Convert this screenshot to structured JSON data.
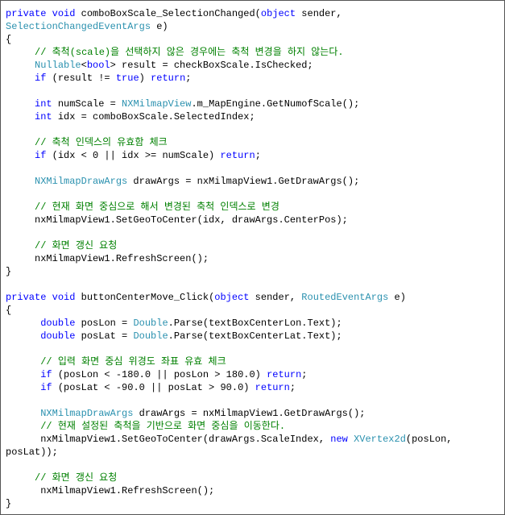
{
  "code": {
    "t1": "private",
    "t2": "void",
    "t3": " comboBoxScale_SelectionChanged(",
    "t4": "object",
    "t5": " sender,",
    "t6": "SelectionChangedEventArgs",
    "t7": " e)",
    "t8": "{",
    "t9": "     ",
    "t10": "// 축척(scale)을 선택하지 않은 경우에는 축척 변경을 하지 않는다.",
    "t11": "     ",
    "t12": "Nullable",
    "t13": "<",
    "t14": "bool",
    "t15": "> result = checkBoxScale.IsChecked;",
    "t16": "     ",
    "t17": "if",
    "t18": " (result != ",
    "t19": "true",
    "t20": ") ",
    "t21": "return",
    "t22": ";",
    "t24": "     ",
    "t25": "int",
    "t26": " numScale = ",
    "t27": "NXMilmapView",
    "t28": ".m_MapEngine.GetNumofScale();",
    "t29": "     ",
    "t30": "int",
    "t31": " idx = comboBoxScale.SelectedIndex;",
    "t33": "     ",
    "t34": "// 축척 인덱스의 유효함 체크",
    "t35": "     ",
    "t36": "if",
    "t37": " (idx < 0 || idx >= numScale) ",
    "t38": "return",
    "t39": ";",
    "t41": "     ",
    "t42": "NXMilmapDrawArgs",
    "t43": " drawArgs = nxMilmapView1.GetDrawArgs();",
    "t45": "     ",
    "t46": "// 현재 화면 중심으로 해서 변경된 축척 인덱스로 변경",
    "t47": "     nxMilmapView1.SetGeoToCenter(idx, drawArgs.CenterPos);",
    "t49": "     ",
    "t50": "// 화면 갱신 요청",
    "t51": "     nxMilmapView1.RefreshScreen();",
    "t52": "}",
    "s1": "private",
    "s2": "void",
    "s3": " buttonCenterMove_Click(",
    "s4": "object",
    "s5": " sender, ",
    "s6": "RoutedEventArgs",
    "s7": " e)",
    "s8": "{",
    "s9": "      ",
    "s10": "double",
    "s11": " posLon = ",
    "s12": "Double",
    "s13": ".Parse(textBoxCenterLon.Text);",
    "s14": "      ",
    "s15": "double",
    "s16": " posLat = ",
    "s17": "Double",
    "s18": ".Parse(textBoxCenterLat.Text);",
    "s20": "      ",
    "s21": "// 입력 화면 중심 위경도 좌표 유효 체크",
    "s22": "      ",
    "s23": "if",
    "s24": " (posLon < -180.0 || posLon > 180.0) ",
    "s25": "return",
    "s26": ";",
    "s27": "      ",
    "s28": "if",
    "s29": " (posLat < -90.0 || posLat > 90.0) ",
    "s30": "return",
    "s31": ";",
    "s33": "      ",
    "s34": "NXMilmapDrawArgs",
    "s35": " drawArgs = nxMilmapView1.GetDrawArgs();",
    "s36": "      ",
    "s37": "// 현재 설정된 축척을 기반으로 화면 중심을 이동한다.",
    "s38": "      nxMilmapView1.SetGeoToCenter(drawArgs.ScaleIndex, ",
    "s39": "new",
    "s40": " ",
    "s41": "XVertex2d",
    "s42": "(posLon,",
    "s43": "posLat));",
    "s45a": "     ",
    "s45b": "// 화면 갱신 요청",
    "s46": "      nxMilmapView1.RefreshScreen();",
    "s47": "}"
  }
}
